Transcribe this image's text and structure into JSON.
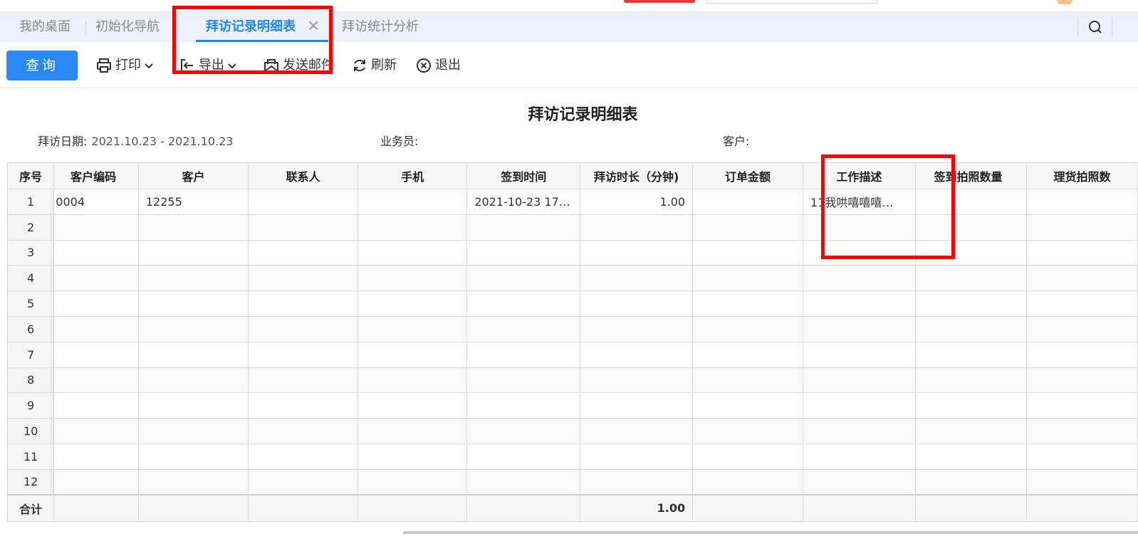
{
  "tabs": [
    {
      "label": "我的桌面"
    },
    {
      "label": "初始化导航"
    },
    {
      "label": "拜访记录明细表"
    },
    {
      "label": "拜访统计分析"
    }
  ],
  "tab_close": "✕",
  "toolbar": {
    "query": "查询",
    "print": "打印",
    "export": "导出",
    "email": "发送邮件",
    "refresh": "刷新",
    "exit": "退出"
  },
  "report": {
    "title": "拜访记录明细表",
    "date_label": "拜访日期:",
    "date_value": "2021.10.23 - 2021.10.23",
    "salesman_label": "业务员:",
    "salesman_value": "",
    "customer_label": "客户:",
    "customer_value": ""
  },
  "table": {
    "columns": [
      "序号",
      "客户编码",
      "客户",
      "联系人",
      "手机",
      "签到时间",
      "拜访时长（分钟)",
      "订单金额",
      "工作描述",
      "签到拍照数量",
      "理货拍照数"
    ],
    "rows": [
      [
        "1",
        "0004",
        "12255",
        "",
        "",
        "2021-10-23 17…",
        "1.00",
        "",
        "11我哄嘻嘻嘻…",
        "",
        ""
      ],
      [
        "2",
        "",
        "",
        "",
        "",
        "",
        "",
        "",
        "",
        "",
        ""
      ],
      [
        "3",
        "",
        "",
        "",
        "",
        "",
        "",
        "",
        "",
        "",
        ""
      ],
      [
        "4",
        "",
        "",
        "",
        "",
        "",
        "",
        "",
        "",
        "",
        ""
      ],
      [
        "5",
        "",
        "",
        "",
        "",
        "",
        "",
        "",
        "",
        "",
        ""
      ],
      [
        "6",
        "",
        "",
        "",
        "",
        "",
        "",
        "",
        "",
        "",
        ""
      ],
      [
        "7",
        "",
        "",
        "",
        "",
        "",
        "",
        "",
        "",
        "",
        ""
      ],
      [
        "8",
        "",
        "",
        "",
        "",
        "",
        "",
        "",
        "",
        "",
        ""
      ],
      [
        "9",
        "",
        "",
        "",
        "",
        "",
        "",
        "",
        "",
        "",
        ""
      ],
      [
        "10",
        "",
        "",
        "",
        "",
        "",
        "",
        "",
        "",
        "",
        ""
      ],
      [
        "11",
        "",
        "",
        "",
        "",
        "",
        "",
        "",
        "",
        "",
        ""
      ],
      [
        "12",
        "",
        "",
        "",
        "",
        "",
        "",
        "",
        "",
        "",
        ""
      ]
    ],
    "total": [
      "合计",
      "",
      "",
      "",
      "",
      "",
      "1.00",
      "",
      "",
      "",
      ""
    ]
  },
  "colors": {
    "accent": "#1f86ff",
    "query_button": "#2b89f5",
    "highlight": "#ff0000"
  }
}
